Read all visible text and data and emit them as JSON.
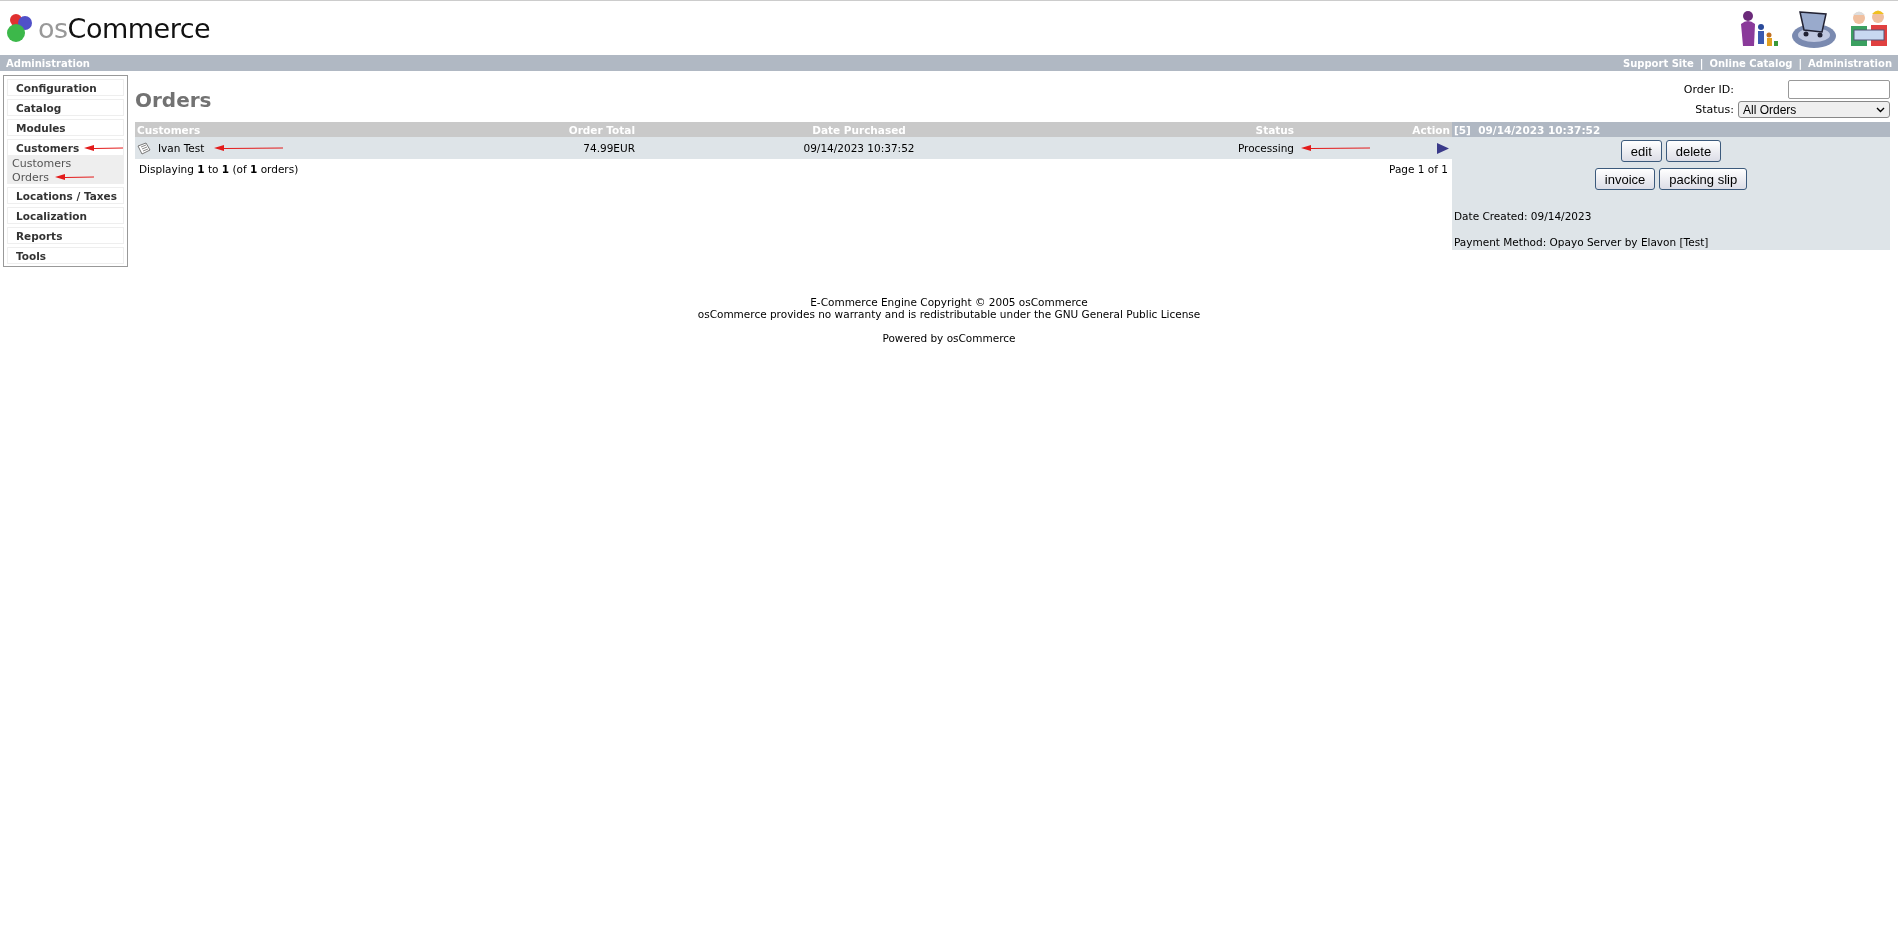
{
  "header": {
    "logo_light": "os",
    "logo_dark": "Commerce"
  },
  "admin_bar": {
    "title": "Administration",
    "links": [
      "Support Site",
      "Online Catalog",
      "Administration"
    ],
    "separator": "|"
  },
  "sidebar": {
    "items": [
      {
        "label": "Configuration",
        "expanded": false,
        "arrow": false
      },
      {
        "label": "Catalog",
        "expanded": false,
        "arrow": false
      },
      {
        "label": "Modules",
        "expanded": false,
        "arrow": false
      },
      {
        "label": "Customers",
        "expanded": true,
        "arrow": true,
        "children": [
          {
            "label": "Customers",
            "arrow": false
          },
          {
            "label": "Orders",
            "arrow": true
          }
        ]
      },
      {
        "label": "Locations / Taxes",
        "expanded": false,
        "arrow": false
      },
      {
        "label": "Localization",
        "expanded": false,
        "arrow": false
      },
      {
        "label": "Reports",
        "expanded": false,
        "arrow": false
      },
      {
        "label": "Tools",
        "expanded": false,
        "arrow": false
      }
    ]
  },
  "page_title": "Orders",
  "filters": {
    "order_id_label": "Order ID:",
    "status_label": "Status:",
    "status_value": "All Orders"
  },
  "table": {
    "columns": [
      "Customers",
      "Order Total",
      "Date Purchased",
      "Status",
      "Action"
    ],
    "rows": [
      {
        "customer": "Ivan Test",
        "total": "74.99EUR",
        "date": "09/14/2023 10:37:52",
        "status": "Processing",
        "selected": true,
        "customer_arrow": true,
        "status_arrow": true
      }
    ],
    "summary": "Displaying **1** to **1** (of **1** orders)",
    "pages": "Page 1 of 1"
  },
  "info_panel": {
    "title": "[5]  09/14/2023 10:37:52",
    "button_rows": [
      [
        "edit",
        "delete"
      ],
      [
        "invoice",
        "packing slip"
      ]
    ],
    "lines": [
      "Date Created: 09/14/2023",
      "Payment Method: Opayo Server by Elavon [Test]"
    ]
  },
  "footer": {
    "lines": [
      "E-Commerce Engine Copyright © 2005 osCommerce",
      "osCommerce provides no warranty and is redistributable under the GNU General Public License"
    ],
    "powered": "Powered by osCommerce"
  }
}
